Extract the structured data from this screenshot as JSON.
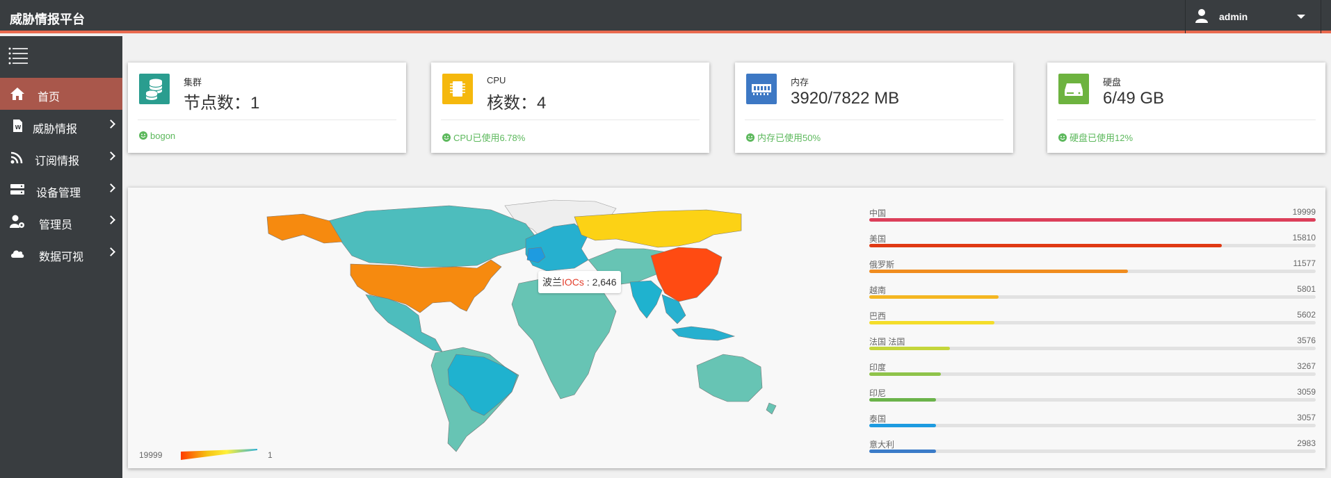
{
  "app": {
    "title": "威胁情报平台"
  },
  "user": {
    "name": "admin",
    "icon": "user-icon"
  },
  "sidebar": {
    "toggle_icon": "hamburger-icon",
    "items": [
      {
        "label": "首页",
        "icon": "home-icon",
        "active": true
      },
      {
        "label": "威胁情报",
        "icon": "document-icon",
        "active": false
      },
      {
        "label": "订阅情报",
        "icon": "rss-icon",
        "active": false
      },
      {
        "label": "设备管理",
        "icon": "server-icon",
        "active": false
      },
      {
        "label": "管理员",
        "icon": "user-gear-icon",
        "active": false
      },
      {
        "label": "数据可视",
        "icon": "cloud-icon",
        "active": false
      }
    ]
  },
  "cards": [
    {
      "label": "集群",
      "value": "节点数：1",
      "status": "bogon",
      "color": "#2a9d8f",
      "icon": "database-icon"
    },
    {
      "label": "CPU",
      "value": "核数：4",
      "status": "CPU已使用6.78%",
      "color": "#f5b80d",
      "icon": "cpu-icon"
    },
    {
      "label": "内存",
      "value": "3920/7822 MB",
      "status": "内存已使用50%",
      "color": "#3d78c4",
      "icon": "memory-icon"
    },
    {
      "label": "硬盘",
      "value": "6/49 GB",
      "status": "硬盘已使用12%",
      "color": "#6db33f",
      "icon": "hard-drive-icon"
    }
  ],
  "map": {
    "tooltip": {
      "country": "波兰",
      "series": "IOCs",
      "sep": " : ",
      "value": "2,646"
    },
    "legend": {
      "max": "19999",
      "min": "1"
    }
  },
  "ranking": [
    {
      "name": "中国",
      "value": 19999,
      "value_label": "19999",
      "color": "#dc3f5a",
      "fraction": 1.0
    },
    {
      "name": "美国",
      "value": 15810,
      "value_label": "15810",
      "color": "#e03a14",
      "fraction": 0.79
    },
    {
      "name": "俄罗斯",
      "value": 11577,
      "value_label": "11577",
      "color": "#f08c1f",
      "fraction": 0.58
    },
    {
      "name": "越南",
      "value": 5801,
      "value_label": "5801",
      "color": "#f4b622",
      "fraction": 0.29
    },
    {
      "name": "巴西",
      "value": 5602,
      "value_label": "5602",
      "color": "#f4dd2a",
      "fraction": 0.28
    },
    {
      "name": "法国 法国",
      "value": 3576,
      "value_label": "3576",
      "color": "#c4d63c",
      "fraction": 0.18
    },
    {
      "name": "印度",
      "value": 3267,
      "value_label": "3267",
      "color": "#8fc34a",
      "fraction": 0.16
    },
    {
      "name": "印尼",
      "value": 3059,
      "value_label": "3059",
      "color": "#6bb34a",
      "fraction": 0.15
    },
    {
      "name": "泰国",
      "value": 3057,
      "value_label": "3057",
      "color": "#1e9be0",
      "fraction": 0.15
    },
    {
      "name": "意大利",
      "value": 2983,
      "value_label": "2983",
      "color": "#3a7bc8",
      "fraction": 0.15
    }
  ]
}
